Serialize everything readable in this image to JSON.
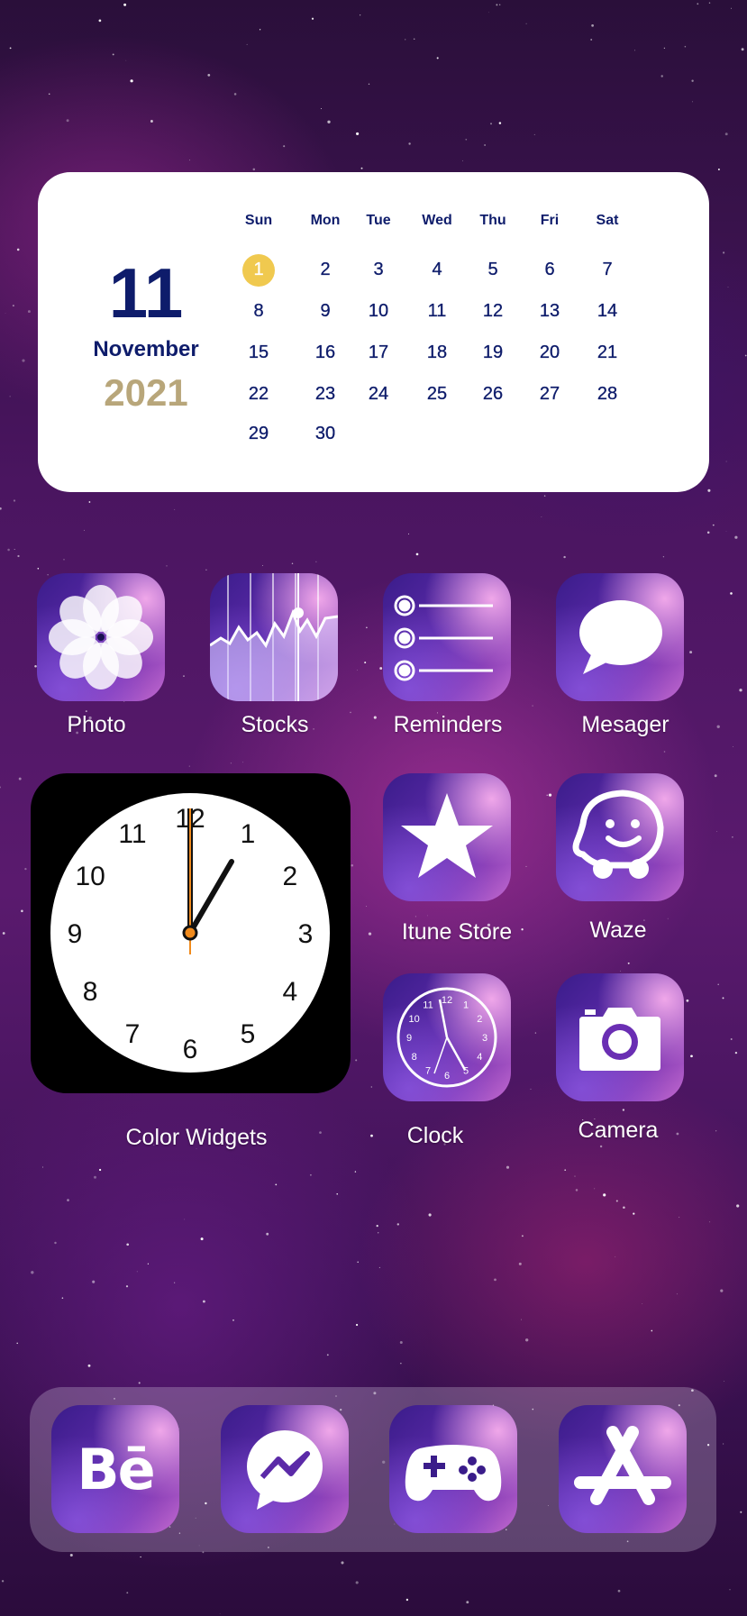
{
  "calendar": {
    "day": "11",
    "month": "November",
    "year": "2021",
    "weekdays": [
      "Sun",
      "Mon",
      "Tue",
      "Wed",
      "Thu",
      "Fri",
      "Sat"
    ],
    "weeks": [
      [
        "1",
        "2",
        "3",
        "4",
        "5",
        "6",
        "7"
      ],
      [
        "8",
        "9",
        "10",
        "11",
        "12",
        "13",
        "14"
      ],
      [
        "15",
        "16",
        "17",
        "18",
        "19",
        "20",
        "21"
      ],
      [
        "22",
        "23",
        "24",
        "25",
        "26",
        "27",
        "28"
      ],
      [
        "29",
        "30",
        "",
        "",
        "",
        "",
        ""
      ]
    ],
    "highlight_day": "1",
    "colors": {
      "text": "#0e1c6b",
      "year": "#b8a67a",
      "highlight": "#f0c94f"
    }
  },
  "apps": {
    "photo": {
      "label": "Photo",
      "icon": "flower-icon"
    },
    "stocks": {
      "label": "Stocks",
      "icon": "stock-chart-icon"
    },
    "reminders": {
      "label": "Reminders",
      "icon": "list-icon"
    },
    "messager": {
      "label": "Mesager",
      "icon": "speech-bubble-icon"
    },
    "itune": {
      "label": "Itune Store",
      "icon": "star-icon"
    },
    "waze": {
      "label": "Waze",
      "icon": "waze-icon"
    },
    "clock": {
      "label": "Clock",
      "icon": "clock-icon"
    },
    "camera": {
      "label": "Camera",
      "icon": "camera-icon"
    }
  },
  "clock_widget": {
    "label": "Color Widgets",
    "numbers": [
      "12",
      "1",
      "2",
      "3",
      "4",
      "5",
      "6",
      "7",
      "8",
      "9",
      "10",
      "11"
    ]
  },
  "dock": [
    {
      "name": "behance",
      "text": "Bē",
      "icon": "behance-icon"
    },
    {
      "name": "messenger",
      "icon": "messenger-icon"
    },
    {
      "name": "games",
      "icon": "gamepad-icon"
    },
    {
      "name": "app-store",
      "icon": "app-store-icon"
    }
  ]
}
